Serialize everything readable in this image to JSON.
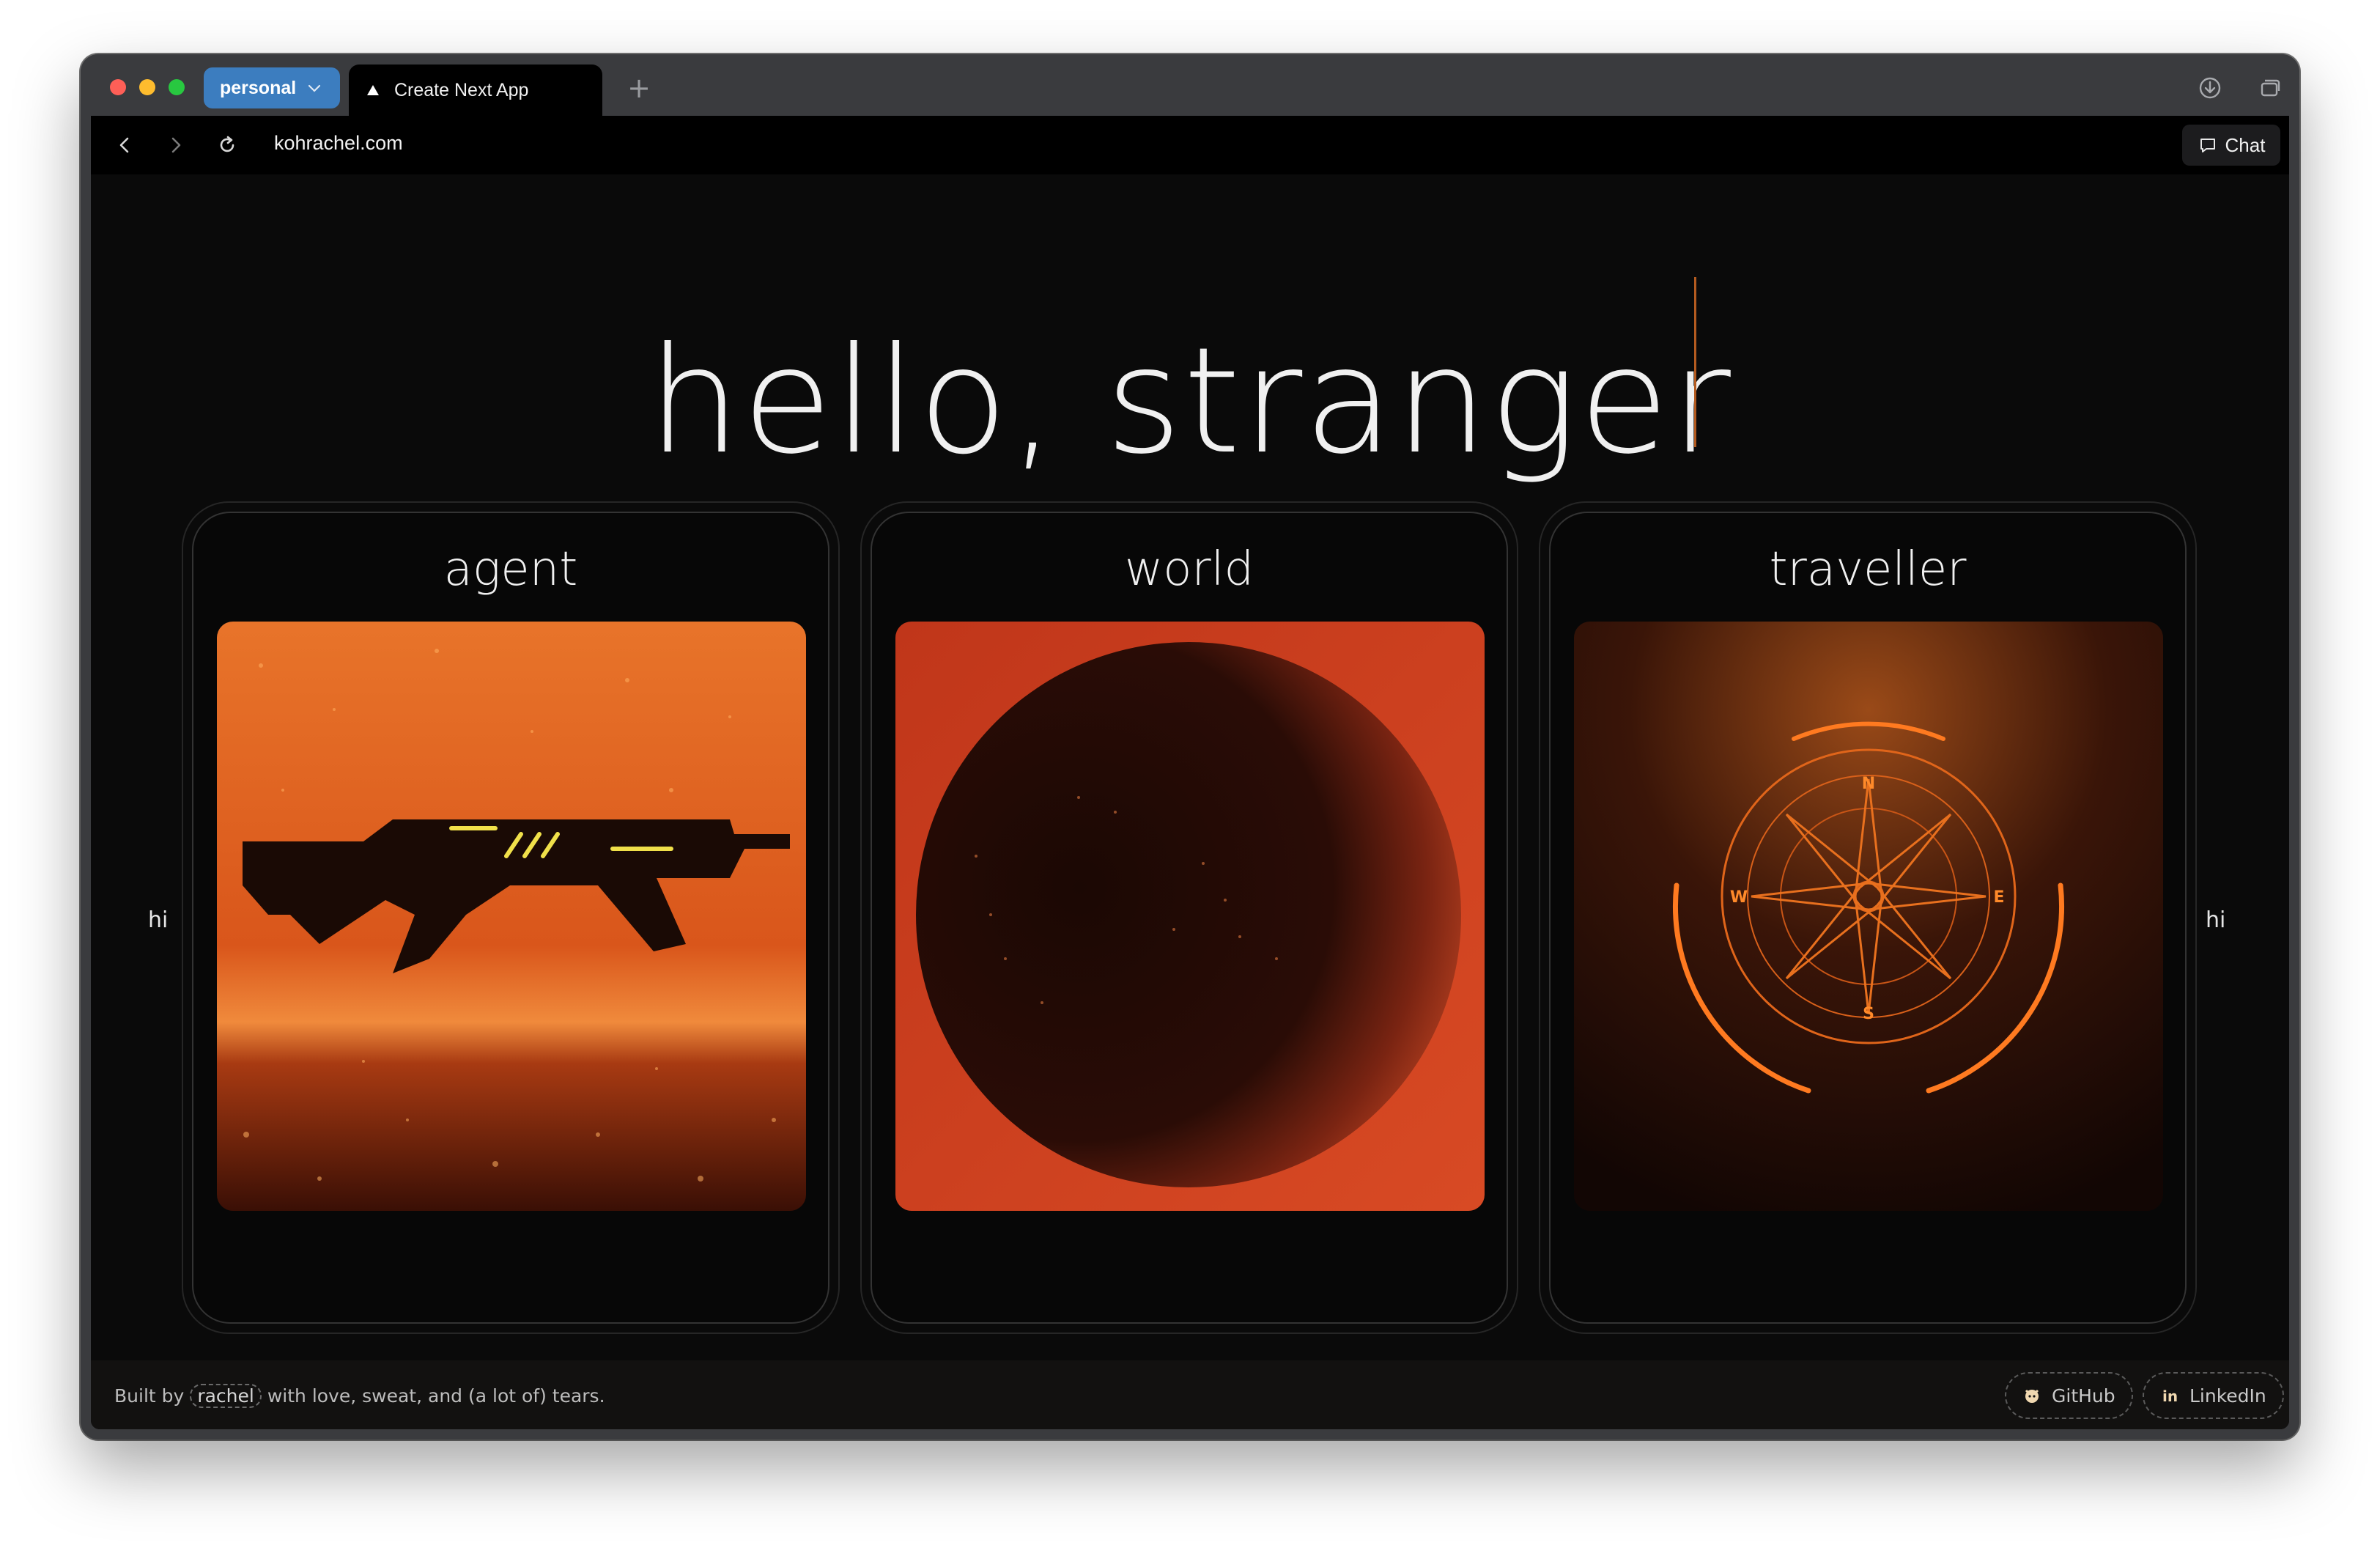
{
  "browser": {
    "profile": "personal",
    "tab_title": "Create Next App",
    "new_tab": "+",
    "url": "kohrachel.com",
    "chat_label": "Chat"
  },
  "hero": {
    "title": "hello, stranger"
  },
  "side": {
    "left": "hi",
    "right": "hi"
  },
  "cards": [
    {
      "title": "agent",
      "image": "futuristic-rifle-image"
    },
    {
      "title": "world",
      "image": "red-planet-image"
    },
    {
      "title": "traveller",
      "image": "glowing-compass-image"
    }
  ],
  "footer": {
    "prefix": "Built by",
    "name": "rachel",
    "suffix": "with love, sweat, and (a lot of) tears.",
    "links": [
      {
        "label": "GitHub",
        "icon": "github-icon"
      },
      {
        "label": "LinkedIn",
        "icon": "linkedin-icon"
      }
    ]
  },
  "colors": {
    "accent_orange": "#e0601c",
    "profile_blue": "#3c7dbf",
    "page_bg": "#0a0a0a"
  }
}
